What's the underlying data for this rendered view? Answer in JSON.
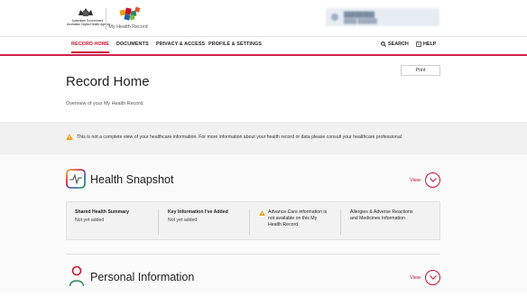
{
  "header": {
    "gov_logo_text": "Australian Government\nAustralian Digital Health Agency",
    "mhr_logo_text": "My Health Record",
    "account_name": "████████",
    "account_sub": "████ ██████"
  },
  "nav": {
    "items": [
      {
        "label": "RECORD HOME",
        "active": true
      },
      {
        "label": "DOCUMENTS",
        "active": false
      },
      {
        "label": "PRIVACY & ACCESS",
        "active": false
      },
      {
        "label": "PROFILE & SETTINGS",
        "active": false
      }
    ],
    "search_label": "SEARCH",
    "help_label": "HELP"
  },
  "page": {
    "print_label": "Print",
    "title": "Record Home",
    "subtitle": "Overview of your My Health Record."
  },
  "warning": {
    "text": "This is not a complete view of your healthcare information. For more information about your health record or data please consult your healthcare professional."
  },
  "health_snapshot": {
    "title": "Health Snapshot",
    "view_label": "View",
    "cells": [
      {
        "label": "Shared Health Summary",
        "value": "Not yet added"
      },
      {
        "label": "Key Information I've Added",
        "value": "Not yet added"
      },
      {
        "label_lines": [
          "Advance Care information is",
          "not available on this My",
          "Health Record."
        ]
      },
      {
        "label_lines": [
          "Allergies & Adverse Reactions",
          "and Medicines Information"
        ]
      }
    ]
  },
  "personal_information": {
    "title": "Personal Information",
    "view_label": "View"
  },
  "colors": {
    "accent": "#c8102e",
    "nav_underline": "#d1214f",
    "warning": "#e8a317"
  }
}
